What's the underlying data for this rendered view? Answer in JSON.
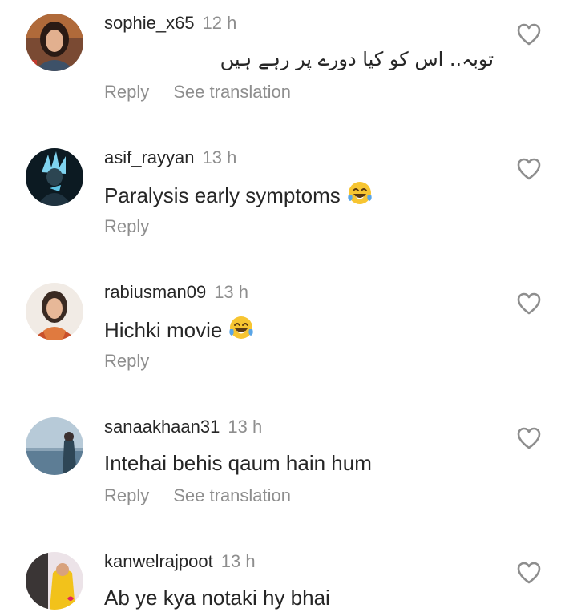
{
  "comments": [
    {
      "username": "sophie_x65",
      "time": "12 h",
      "text": "توبہ.. اس کو کیا دورے پر رہے ہیں",
      "rtl": true,
      "emoji": "",
      "reply_label": "Reply",
      "translation_label": "See translation",
      "avatar_colors": [
        "#5a3b2c",
        "#d9a27a",
        "#8a1f1f"
      ]
    },
    {
      "username": "asif_rayyan",
      "time": "13 h",
      "text": "Paralysis early symptoms",
      "rtl": false,
      "emoji": "😂",
      "reply_label": "Reply",
      "translation_label": "",
      "avatar_colors": [
        "#0b1720",
        "#5fc3e4",
        "#1c3a4a"
      ]
    },
    {
      "username": "rabiusman09",
      "time": "13 h",
      "text": "Hichki movie",
      "rtl": false,
      "emoji": "😂",
      "reply_label": "Reply",
      "translation_label": "",
      "avatar_colors": [
        "#f2ece6",
        "#c9502b",
        "#3a2a22"
      ]
    },
    {
      "username": "sanaakhaan31",
      "time": "13 h",
      "text": "Intehai behis qaum hain hum",
      "rtl": false,
      "emoji": "",
      "reply_label": "Reply",
      "translation_label": "See translation",
      "avatar_colors": [
        "#a9bfd0",
        "#5d7d95",
        "#2e4656"
      ]
    },
    {
      "username": "kanwelrajpoot",
      "time": "13 h",
      "text": "Ab ye kya notaki hy bhai",
      "rtl": false,
      "emoji": "",
      "reply_label": "",
      "translation_label": "",
      "avatar_colors": [
        "#e9dfe6",
        "#f2c21b",
        "#2b2b2b"
      ]
    }
  ],
  "icons": {
    "like": "heart-outline-icon",
    "laugh": "face-with-tears-of-joy-emoji"
  },
  "colors": {
    "text_primary": "#262626",
    "text_secondary": "#8e8e8e",
    "background": "#ffffff"
  }
}
